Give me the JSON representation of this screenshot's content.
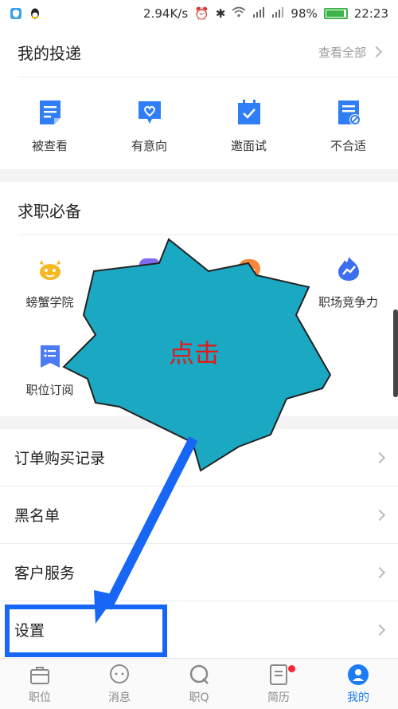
{
  "status_bar": {
    "net_speed": "2.94K/s",
    "battery": "98%",
    "time": "22:23"
  },
  "deliveries": {
    "title": "我的投递",
    "view_all": "查看全部",
    "items": [
      {
        "label": "被查看",
        "icon": "document-icon"
      },
      {
        "label": "有意向",
        "icon": "heart-message-icon"
      },
      {
        "label": "邀面试",
        "icon": "calendar-check-icon"
      },
      {
        "label": "不合适",
        "icon": "document-forbidden-icon"
      }
    ]
  },
  "essentials": {
    "title": "求职必备",
    "items": [
      {
        "label": "螃蟹学院",
        "icon": "crab-icon"
      },
      {
        "label": "",
        "icon": "purple-icon"
      },
      {
        "label": "",
        "icon": "smile-icon"
      },
      {
        "label": "职场竞争力",
        "icon": "flame-trend-icon"
      },
      {
        "label": "职位订阅",
        "icon": "subscription-icon"
      }
    ]
  },
  "menu": [
    {
      "label": "订单购买记录"
    },
    {
      "label": "黑名单"
    },
    {
      "label": "客户服务"
    },
    {
      "label": "设置"
    }
  ],
  "tabs": [
    {
      "label": "职位",
      "icon": "briefcase-icon"
    },
    {
      "label": "消息",
      "icon": "chat-icon"
    },
    {
      "label": "职Q",
      "icon": "q-bubble-icon"
    },
    {
      "label": "简历",
      "icon": "resume-icon"
    },
    {
      "label": "我的",
      "icon": "profile-icon"
    }
  ],
  "annotation": {
    "callout_text": "点击",
    "callout_color": "#1ba8c2",
    "arrow_color": "#1766f5",
    "text_color": "#e01b1b"
  },
  "colors": {
    "accent": "#1b7cf5",
    "icon_blue": "#2f7ef6"
  }
}
